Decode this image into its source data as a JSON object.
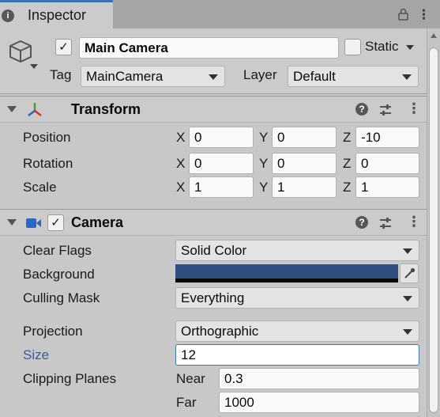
{
  "tab": {
    "title": "Inspector",
    "info_icon": "info-icon",
    "lock_icon": "lock-icon",
    "menu_icon": "kebab-icon"
  },
  "header": {
    "object_icon": "cube-icon",
    "active": true,
    "name": "Main Camera",
    "static_label": "Static",
    "static_checked": false,
    "tag_label": "Tag",
    "tag_value": "MainCamera",
    "layer_label": "Layer",
    "layer_value": "Default"
  },
  "transform": {
    "title": "Transform",
    "icon": "transform-axes-icon",
    "rows": [
      {
        "label": "Position",
        "x": "0",
        "y": "0",
        "z": "-10"
      },
      {
        "label": "Rotation",
        "x": "0",
        "y": "0",
        "z": "0"
      },
      {
        "label": "Scale",
        "x": "1",
        "y": "1",
        "z": "1"
      }
    ],
    "axes": [
      "X",
      "Y",
      "Z"
    ]
  },
  "camera": {
    "title": "Camera",
    "icon": "video-camera-icon",
    "enabled": true,
    "clear_flags_label": "Clear Flags",
    "clear_flags_value": "Solid Color",
    "background_label": "Background",
    "background_color": "#2f4e7d",
    "culling_mask_label": "Culling Mask",
    "culling_mask_value": "Everything",
    "projection_label": "Projection",
    "projection_value": "Orthographic",
    "size_label": "Size",
    "size_value": "12",
    "clipping_label": "Clipping Planes",
    "near_label": "Near",
    "near_value": "0.3",
    "far_label": "Far",
    "far_value": "1000"
  },
  "colors": {
    "accent": "#3a72b0",
    "panel": "#cbcbcb",
    "focus": "#3a79bb",
    "x_axis": "#d0342c",
    "y_axis": "#4c9a3c",
    "z_axis": "#2c65c8"
  }
}
